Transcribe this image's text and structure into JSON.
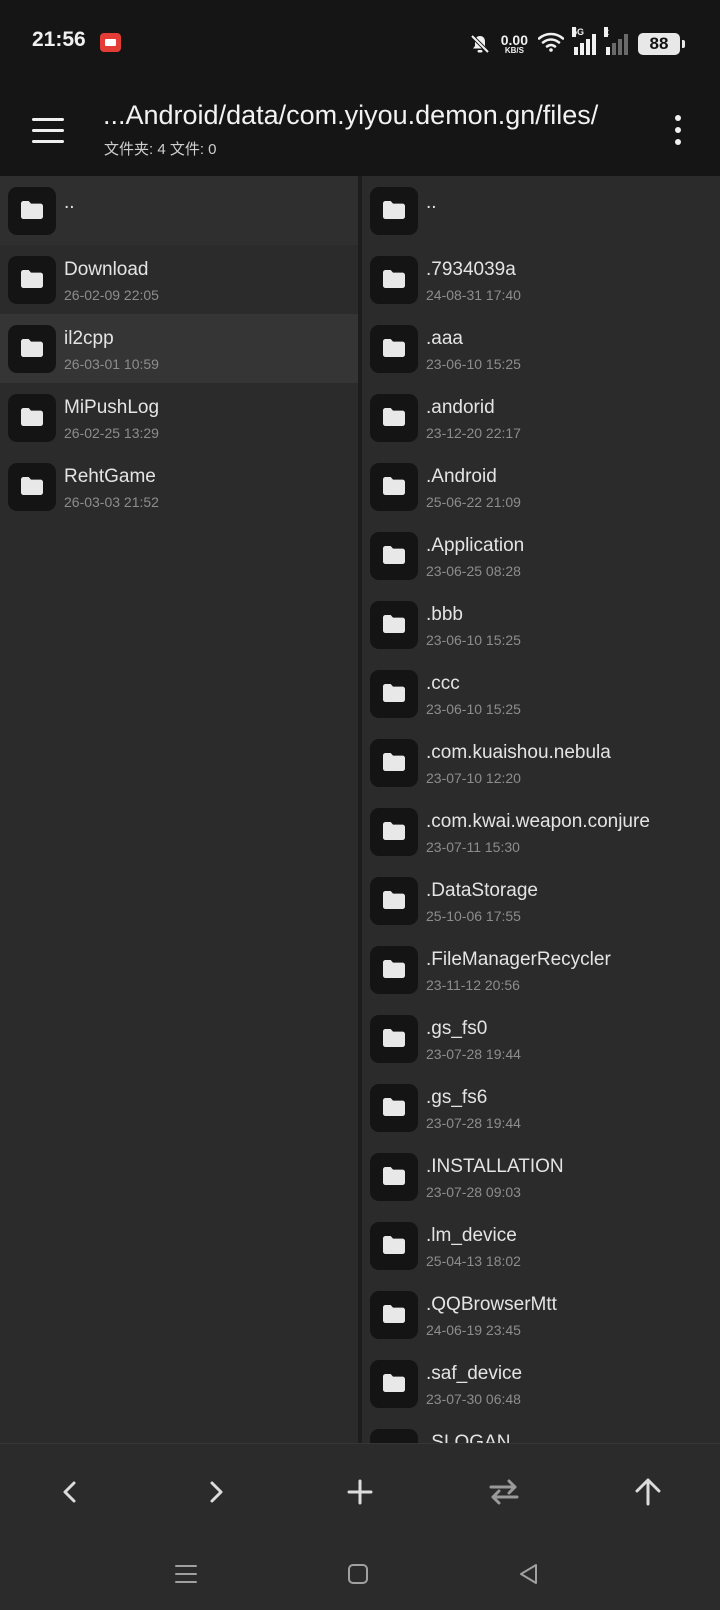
{
  "status_bar": {
    "time": "21:56",
    "record_icon": "screen-record-icon",
    "net_speed_value": "0.00",
    "net_speed_unit": "KB/S",
    "signal_tag_1": "5G",
    "signal_tag_2": "x",
    "battery": "88"
  },
  "app_bar": {
    "path": "...Android/data/com.yiyou.demon.gn/files/",
    "summary": "文件夹: 4  文件: 0"
  },
  "left_pane": {
    "items": [
      {
        "name": "..",
        "date": ""
      },
      {
        "name": "Download",
        "date": "26-02-09 22:05"
      },
      {
        "name": "il2cpp",
        "date": "26-03-01 10:59"
      },
      {
        "name": "MiPushLog",
        "date": "26-02-25 13:29"
      },
      {
        "name": "RehtGame",
        "date": "26-03-03 21:52"
      }
    ]
  },
  "right_pane": {
    "items": [
      {
        "name": "..",
        "date": ""
      },
      {
        "name": ".7934039a",
        "date": "24-08-31 17:40"
      },
      {
        "name": ".aaa",
        "date": "23-06-10 15:25"
      },
      {
        "name": ".andorid",
        "date": "23-12-20 22:17"
      },
      {
        "name": ".Android",
        "date": "25-06-22 21:09"
      },
      {
        "name": ".Application",
        "date": "23-06-25 08:28"
      },
      {
        "name": ".bbb",
        "date": "23-06-10 15:25"
      },
      {
        "name": ".ccc",
        "date": "23-06-10 15:25"
      },
      {
        "name": ".com.kuaishou.nebula",
        "date": "23-07-10 12:20"
      },
      {
        "name": ".com.kwai.weapon.conjure",
        "date": "23-07-11 15:30"
      },
      {
        "name": ".DataStorage",
        "date": "25-10-06 17:55"
      },
      {
        "name": ".FileManagerRecycler",
        "date": "23-11-12 20:56"
      },
      {
        "name": ".gs_fs0",
        "date": "23-07-28 19:44"
      },
      {
        "name": ".gs_fs6",
        "date": "23-07-28 19:44"
      },
      {
        "name": ".INSTALLATION",
        "date": "23-07-28 09:03"
      },
      {
        "name": ".lm_device",
        "date": "25-04-13 18:02"
      },
      {
        "name": ".QQBrowserMtt",
        "date": "24-06-19 23:45"
      },
      {
        "name": ".saf_device",
        "date": "23-07-30 06:48"
      },
      {
        "name": ".SLOGAN",
        "date": ""
      }
    ]
  },
  "toolbar": {
    "icons": [
      "back-arrow-icon",
      "forward-arrow-icon",
      "add-icon",
      "swap-panes-icon",
      "up-directory-icon"
    ]
  },
  "colors": {
    "background": "#151515",
    "pane": "#2b2b2b",
    "icon_bg": "#141414",
    "text": "#e4e4e4",
    "subtext": "#8d8d8d"
  }
}
